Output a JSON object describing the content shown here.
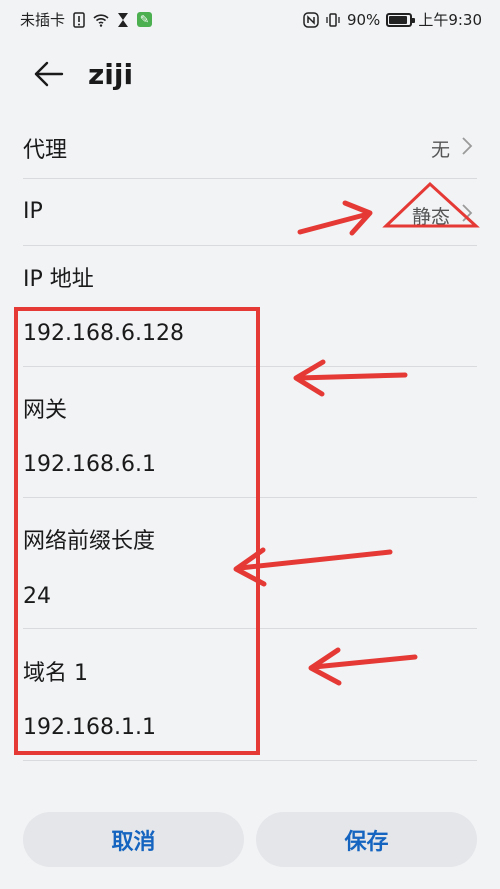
{
  "status_bar": {
    "carrier": "未插卡",
    "battery": "90%",
    "time": "上午9:30"
  },
  "header": {
    "title": "ziji"
  },
  "rows": {
    "proxy_label": "代理",
    "proxy_value": "无",
    "ip_label": "IP",
    "ip_value": "静态",
    "ip_address_label": "IP 地址",
    "ip_address_value": "192.168.6.128",
    "gateway_label": "网关",
    "gateway_value": "192.168.6.1",
    "prefix_label": "网络前缀长度",
    "prefix_value": "24",
    "dns1_label": "域名 1",
    "dns1_value": "192.168.1.1"
  },
  "footer": {
    "cancel_label": "取消",
    "save_label": "保存"
  },
  "colors": {
    "background": "#f1f3f5",
    "accent": "#1565c0",
    "annotation": "#e53935"
  }
}
